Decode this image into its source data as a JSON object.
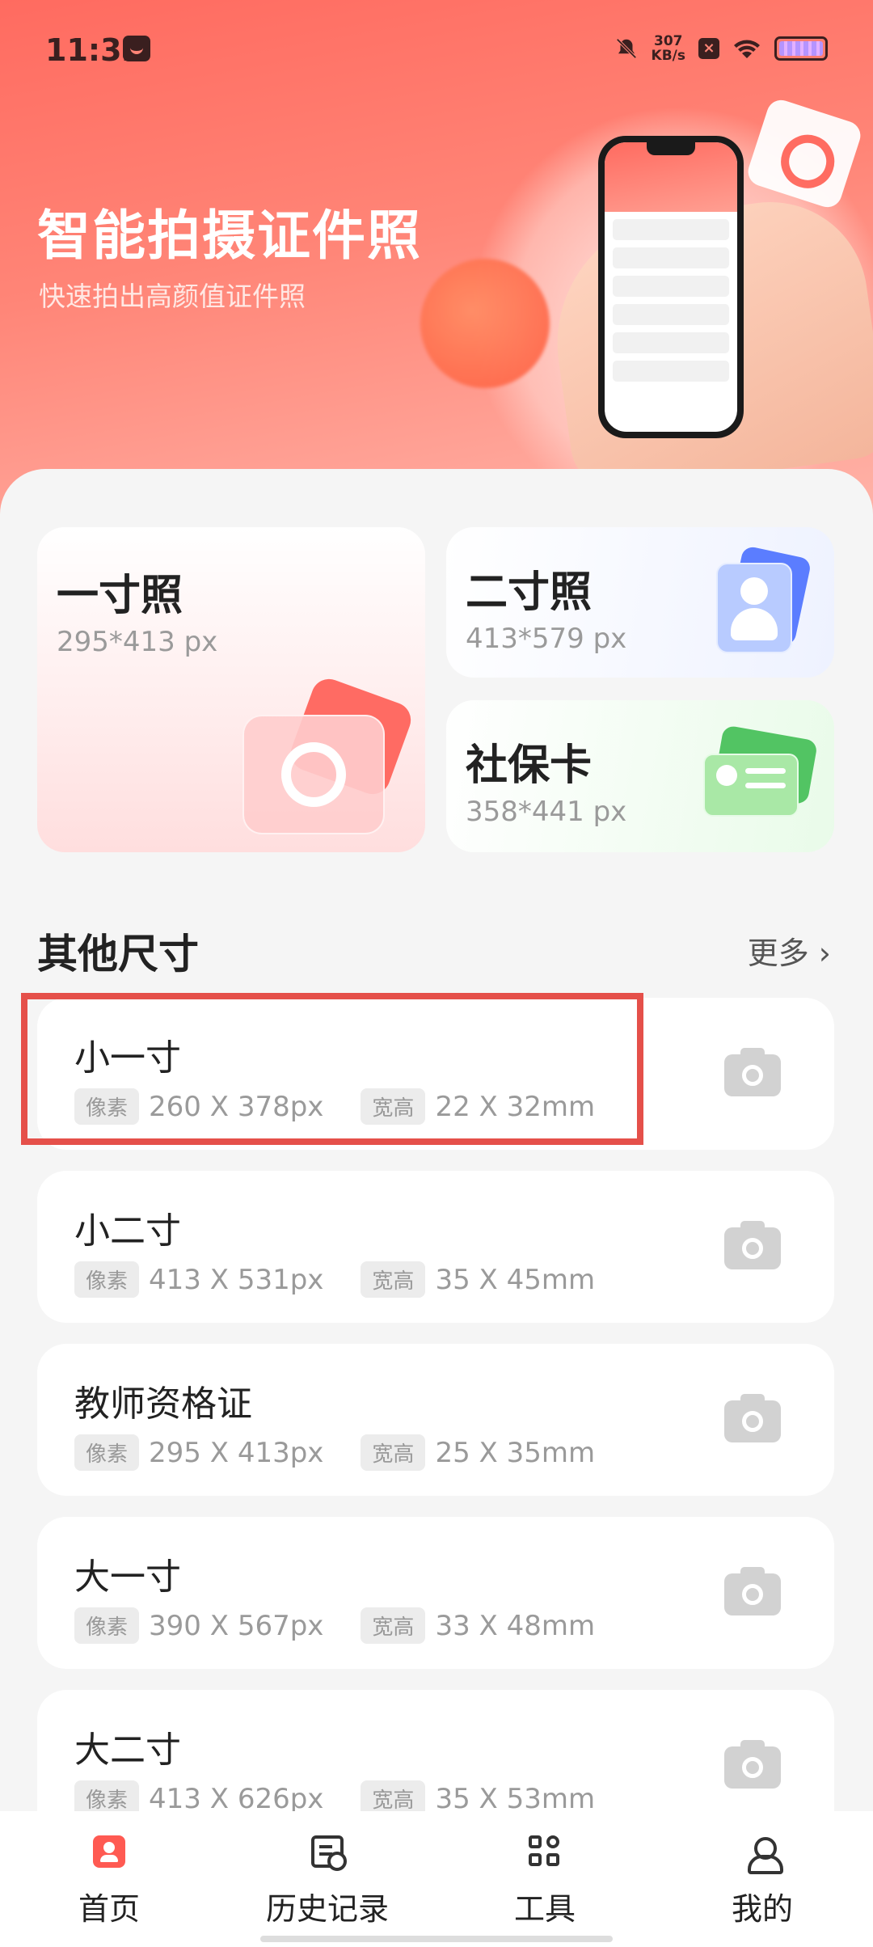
{
  "status_bar": {
    "time": "11:32",
    "net_speed_value": "307",
    "net_speed_unit": "KB/s"
  },
  "hero": {
    "title": "智能拍摄证件照",
    "subtitle": "快速拍出高颜值证件照"
  },
  "cards": [
    {
      "title": "一寸照",
      "size": "295*413 px"
    },
    {
      "title": "二寸照",
      "size": "413*579 px"
    },
    {
      "title": "社保卡",
      "size": "358*441 px"
    }
  ],
  "section": {
    "title": "其他尺寸",
    "more": "更多 ›"
  },
  "tags": {
    "pixel": "像素",
    "dims": "宽高"
  },
  "items": [
    {
      "name": "小一寸",
      "px": "260 X 378px",
      "mm": "22 X 32mm"
    },
    {
      "name": "小二寸",
      "px": "413 X 531px",
      "mm": "35 X 45mm"
    },
    {
      "name": "教师资格证",
      "px": "295 X 413px",
      "mm": "25 X 35mm"
    },
    {
      "name": "大一寸",
      "px": "390 X 567px",
      "mm": "33 X 48mm"
    },
    {
      "name": "大二寸",
      "px": "413 X 626px",
      "mm": "35 X 53mm"
    }
  ],
  "tabs": [
    {
      "label": "首页",
      "icon": "home-icon",
      "active": true
    },
    {
      "label": "历史记录",
      "icon": "history-icon",
      "active": false
    },
    {
      "label": "工具",
      "icon": "tools-icon",
      "active": false
    },
    {
      "label": "我的",
      "icon": "profile-icon",
      "active": false
    }
  ],
  "colors": {
    "accent": "#ff5a52",
    "highlight": "#e5504a",
    "muted": "#9a9a9a"
  }
}
